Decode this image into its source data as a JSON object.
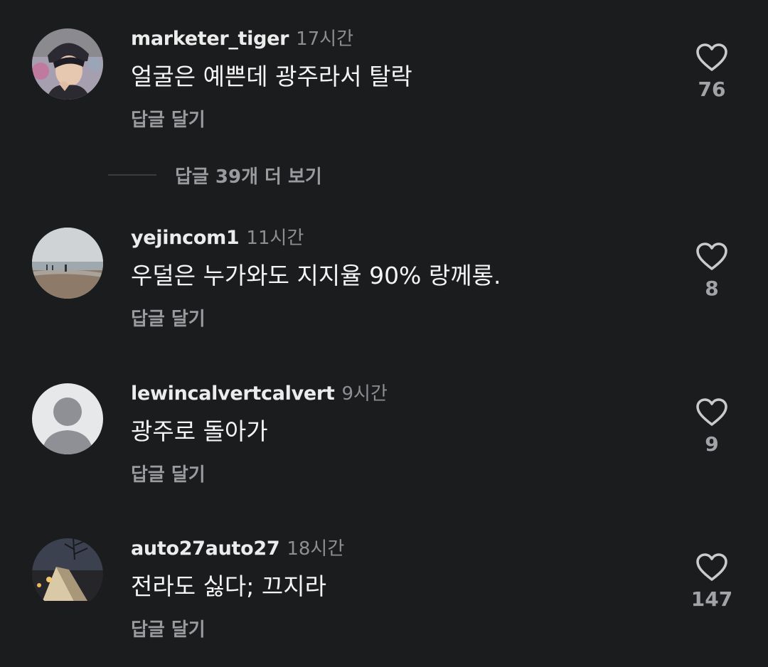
{
  "comments": [
    {
      "username": "marketer_tiger",
      "time": "17시간",
      "text": "얼굴은 예쁜데 광주라서 탈락",
      "reply_label": "답글 달기",
      "likes": "76",
      "avatar_icon": "photo-avatar"
    },
    {
      "username": "yejincom1",
      "time": "11시간",
      "text": "우덜은 누가와도 지지율 90% 랑께롱.",
      "reply_label": "답글 달기",
      "likes": "8",
      "avatar_icon": "beach-photo-avatar"
    },
    {
      "username": "lewincalvertcalvert",
      "time": "9시간",
      "text": "광주로 돌아가",
      "reply_label": "답글 달기",
      "likes": "9",
      "avatar_icon": "default-user-avatar"
    },
    {
      "username": "auto27auto27",
      "time": "18시간",
      "text": "전라도 싫다; 끄지라",
      "reply_label": "답글 달기",
      "likes": "147",
      "avatar_icon": "camping-photo-avatar"
    }
  ],
  "more_replies": {
    "label": "답글 39개 더 보기"
  },
  "colors": {
    "background": "#1b1c1e",
    "username": "#ececec",
    "time": "#8d8e92",
    "secondary": "#9a9b9f",
    "heart_outline": "#c9cacd"
  }
}
